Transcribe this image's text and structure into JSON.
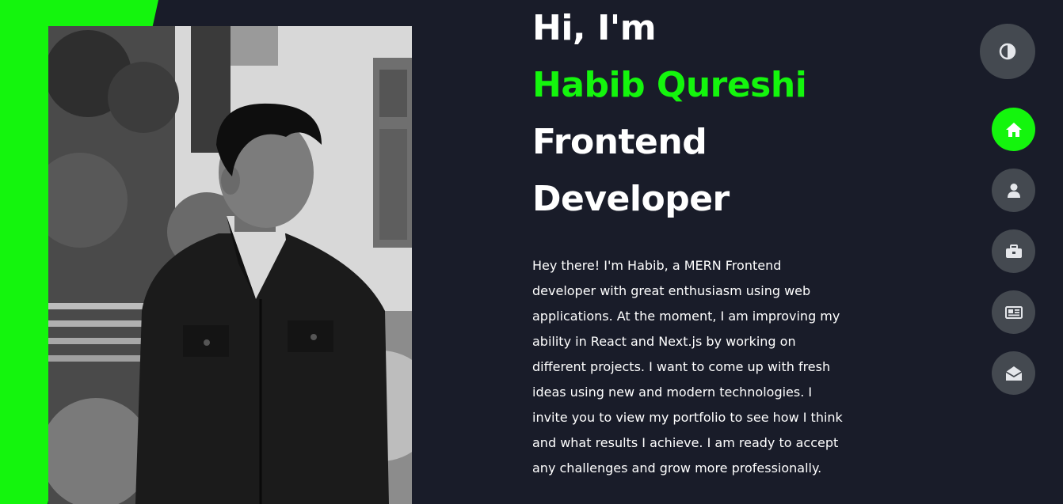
{
  "colors": {
    "accent": "#14f50d",
    "background": "#191c29",
    "nav_button": "#444950",
    "text": "#ffffff"
  },
  "hero": {
    "greeting": "Hi, I'm",
    "name": "Habib Qureshi",
    "role_line1": "Frontend",
    "role_line2": "Developer",
    "bio": "Hey there! I'm Habib, a MERN Frontend developer with great enthusiasm using web applications. At the moment, I am improving my ability in React and Next.js by working on different projects. I want to come up with fresh ideas using new and modern technologies. I invite you to view my portfolio to see how I think and what results I achieve. I am ready to accept any challenges and grow more professionally."
  },
  "theme_toggle": {
    "icon": "contrast-icon"
  },
  "nav": {
    "items": [
      {
        "id": "home",
        "icon": "home-icon",
        "active": true
      },
      {
        "id": "about",
        "icon": "user-icon",
        "active": false
      },
      {
        "id": "portfolio",
        "icon": "briefcase-icon",
        "active": false
      },
      {
        "id": "blog",
        "icon": "newspaper-icon",
        "active": false
      },
      {
        "id": "contact",
        "icon": "envelope-open-icon",
        "active": false
      }
    ]
  }
}
